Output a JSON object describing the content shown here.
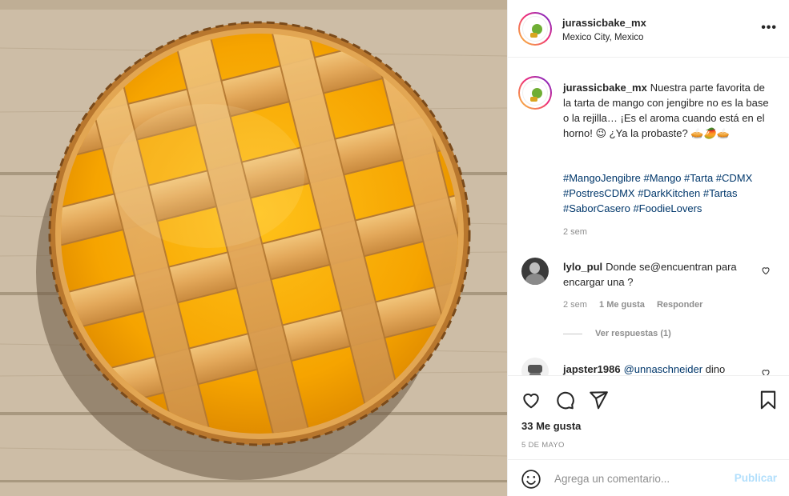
{
  "post": {
    "username": "jurassicbake_mx",
    "location": "Mexico City, Mexico",
    "caption": "Nuestra parte favorita de la tarta de mango con jengibre no es la base o la rejilla… ¡Es el aroma cuando está en el horno! 😉 ¿Ya la probaste? 🥧🥭🥧",
    "hashtags": "#MangoJengibre #Mango #Tarta #CDMX #PostresCDMX #DarkKitchen #Tartas #SaborCasero #FoodieLovers",
    "caption_time": "2 sem",
    "likes": "33 Me gusta",
    "date": "5 DE MAYO"
  },
  "comments": [
    {
      "username": "lylo_pul",
      "text": "Donde se@encuentran para encargar una ?",
      "time": "2 sem",
      "likes": "1 Me gusta",
      "reply": "Responder",
      "view_replies": "Ver respuestas (1)"
    },
    {
      "username": "japster1986",
      "mention": "@unnaschneider",
      "text": "dino"
    }
  ],
  "add_comment": {
    "placeholder": "Agrega un comentario...",
    "publish": "Publicar"
  },
  "icons": {
    "more": "more-options-icon",
    "like": "heart-icon",
    "comment": "comment-icon",
    "share": "share-icon",
    "save": "bookmark-icon",
    "emoji": "emoji-icon"
  },
  "colors": {
    "link": "#00376b",
    "muted": "#8e8e8e",
    "publish_disabled": "#b2dffc"
  }
}
